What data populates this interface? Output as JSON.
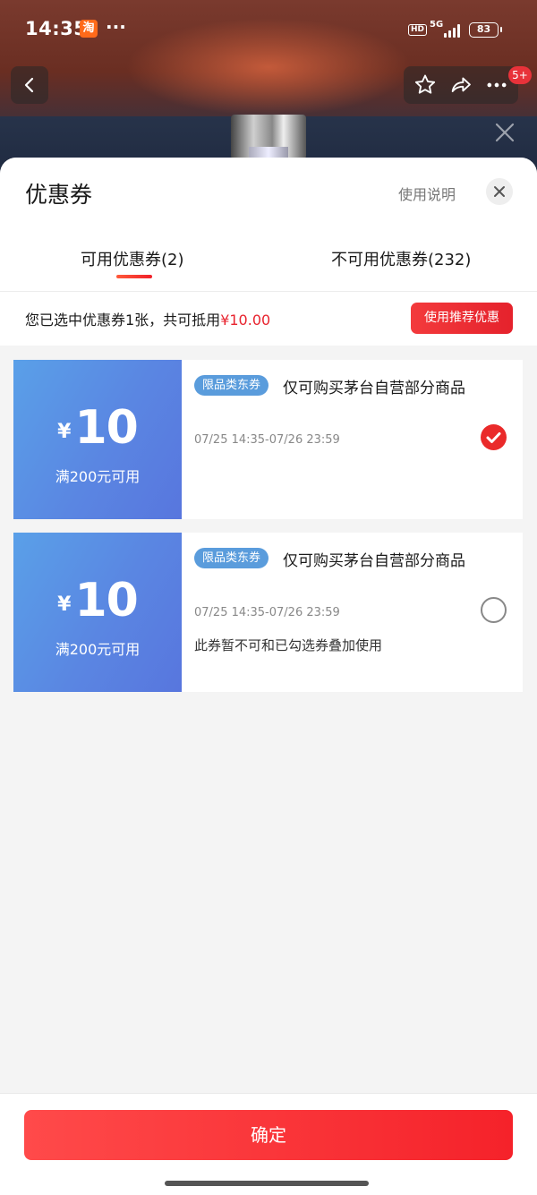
{
  "status_bar": {
    "time": "14:35",
    "app_icon_label": "淘",
    "more": "···",
    "hd": "HD",
    "network": "5G",
    "battery": "83"
  },
  "nav": {
    "back_icon": "chevron-left-icon",
    "favorite_icon": "star-icon",
    "share_icon": "share-icon",
    "more_icon": "more-dots-icon",
    "badge": "5+"
  },
  "sheet": {
    "title": "优惠券",
    "help_link": "使用说明",
    "tabs": [
      {
        "label": "可用优惠券(2)",
        "active": true
      },
      {
        "label": "不可用优惠券(232)",
        "active": false
      }
    ],
    "summary_prefix": "您已选中优惠券1张，共可抵用",
    "summary_amount": "¥10.00",
    "recommend_button": "使用推荐优惠"
  },
  "coupons": [
    {
      "currency": "¥",
      "amount": "10",
      "condition": "满200元可用",
      "tag": "限品类东券",
      "description": "仅可购买茅台自营部分商品",
      "validity": "07/25 14:35-07/26 23:59",
      "note": "",
      "selected": true
    },
    {
      "currency": "¥",
      "amount": "10",
      "condition": "满200元可用",
      "tag": "限品类东券",
      "description": "仅可购买茅台自营部分商品",
      "validity": "07/25 14:35-07/26 23:59",
      "note": "此券暂不可和已勾选券叠加使用",
      "selected": false
    }
  ],
  "footer": {
    "confirm_button": "确定"
  },
  "colors": {
    "accent_red": "#e8232e",
    "coupon_blue": "#5a86e2",
    "tag_blue": "#5a9cdc"
  }
}
